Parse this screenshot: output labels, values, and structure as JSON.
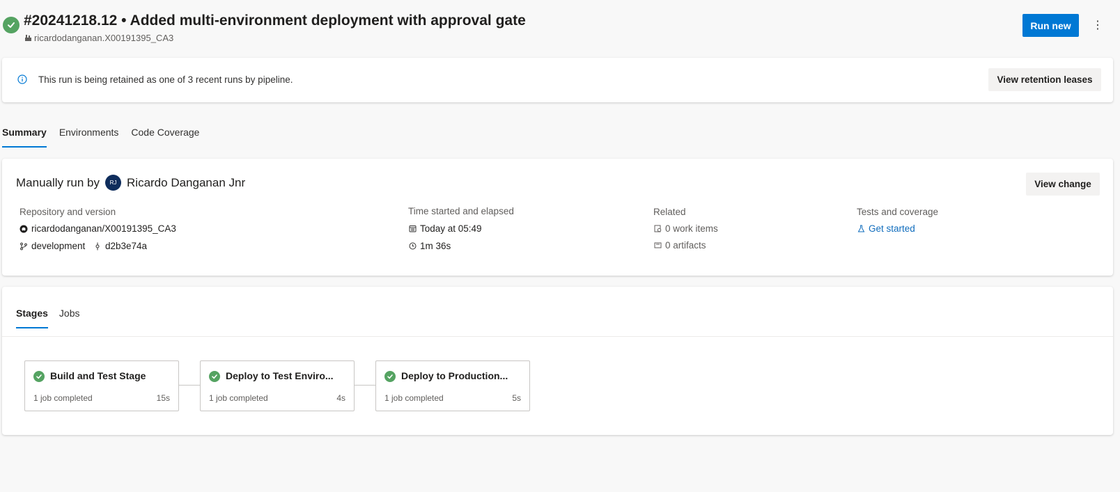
{
  "header": {
    "title": "#20241218.12 • Added multi-environment deployment with approval gate",
    "pipeline": "ricardodanganan.X00191395_CA3",
    "run_new_label": "Run new",
    "more_label": "⋮"
  },
  "retention": {
    "message": "This run is being retained as one of 3 recent runs by pipeline.",
    "button_label": "View retention leases"
  },
  "tabs": [
    "Summary",
    "Environments",
    "Code Coverage"
  ],
  "summary": {
    "manual_run_prefix": "Manually run by",
    "avatar_initials": "RJ",
    "user_name": "Ricardo Danganan Jnr",
    "view_change_label": "View change",
    "repository": {
      "heading": "Repository and version",
      "repo": "ricardodanganan/X00191395_CA3",
      "branch": "development",
      "commit": "d2b3e74a"
    },
    "time": {
      "heading": "Time started and elapsed",
      "started": "Today at 05:49",
      "elapsed": "1m 36s"
    },
    "related": {
      "heading": "Related",
      "work_items": "0 work items",
      "artifacts": "0 artifacts"
    },
    "tests": {
      "heading": "Tests and coverage",
      "link": "Get started"
    }
  },
  "stages_tabs": [
    "Stages",
    "Jobs"
  ],
  "stages": [
    {
      "name": "Build and Test Stage",
      "jobs": "1 job completed",
      "duration": "15s"
    },
    {
      "name": "Deploy to Test Enviro...",
      "jobs": "1 job completed",
      "duration": "4s"
    },
    {
      "name": "Deploy to Production...",
      "jobs": "1 job completed",
      "duration": "5s"
    }
  ],
  "colors": {
    "accent": "#0078d4",
    "success": "#55a362",
    "link": "#0f6cbd"
  }
}
